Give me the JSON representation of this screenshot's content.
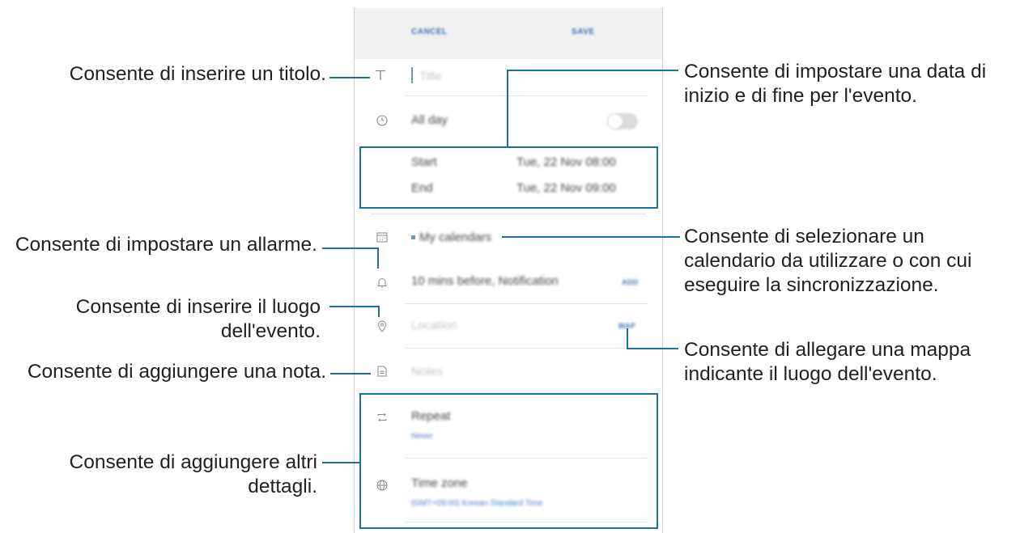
{
  "topbar": {
    "cancel": "CANCEL",
    "save": "SAVE"
  },
  "form": {
    "title_placeholder": "Title",
    "all_day": "All day",
    "start_label": "Start",
    "start_value": "Tue, 22 Nov   08:00",
    "end_label": "End",
    "end_value": "Tue, 22 Nov   09:00",
    "calendar": "My calendars",
    "reminder": "10 mins before, Notification",
    "reminder_action": "ADD",
    "location_placeholder": "Location",
    "map_action": "MAP",
    "notes_placeholder": "Notes",
    "repeat_label": "Repeat",
    "repeat_value": "Never",
    "timezone_label": "Time zone",
    "timezone_value": "(GMT+09:00) Korean Standard Time"
  },
  "callouts": {
    "title": "Consente di inserire un titolo.",
    "dates": [
      "Consente di impostare una data di",
      "inizio e di fine per l'evento."
    ],
    "alarm": "Consente di impostare un allarme.",
    "location": [
      "Consente di inserire il luogo",
      "dell'evento."
    ],
    "note": "Consente di aggiungere una nota.",
    "details": [
      "Consente di aggiungere altri",
      "dettagli."
    ],
    "calendar": [
      "Consente di selezionare un",
      "calendario da utilizzare o con cui",
      "eseguire la sincronizzazione."
    ],
    "map": [
      "Consente di allegare una mappa",
      "indicante il luogo dell'evento."
    ]
  },
  "colors": {
    "accent": "#1b6fa8",
    "link": "#3b6fb6",
    "topbar": "#f0f0f0",
    "text": "#231f20"
  },
  "icons": [
    "text-title-icon",
    "clock-icon",
    "calendar-icon",
    "bell-icon",
    "location-pin-icon",
    "note-icon",
    "repeat-icon",
    "globe-icon"
  ]
}
